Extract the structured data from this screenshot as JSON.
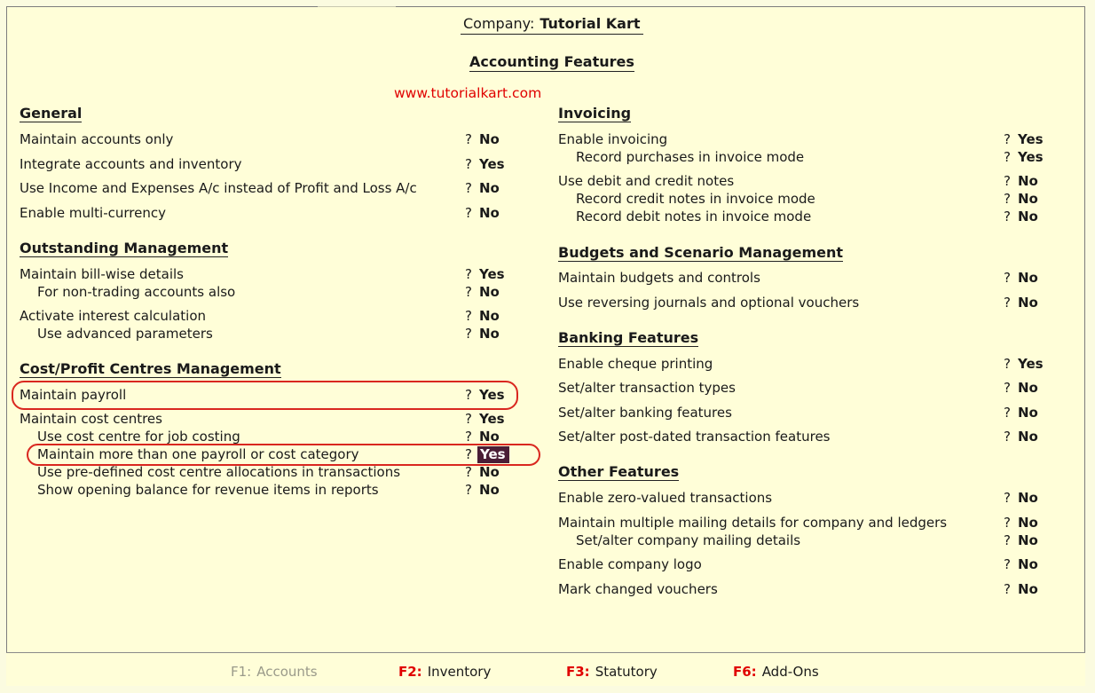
{
  "header": {
    "company_label": "Company:",
    "company_name": "Tutorial Kart",
    "title": "Accounting Features",
    "watermark": "www.tutorialkart.com"
  },
  "left": {
    "general": {
      "title": "General",
      "rows": [
        {
          "label": "Maintain accounts only",
          "q": "?",
          "value": "No"
        },
        {
          "label": "Integrate accounts and inventory",
          "q": "?",
          "value": "Yes"
        },
        {
          "label": "Use Income and Expenses A/c instead of Profit and Loss A/c",
          "q": "?",
          "value": "No"
        },
        {
          "label": "Enable multi-currency",
          "q": "?",
          "value": "No"
        }
      ]
    },
    "outstanding": {
      "title": "Outstanding Management",
      "rows": [
        {
          "label": "Maintain bill-wise details",
          "q": "?",
          "value": "Yes"
        },
        {
          "label": "For non-trading accounts also",
          "q": "?",
          "value": "No"
        },
        {
          "label": "Activate interest calculation",
          "q": "?",
          "value": "No"
        },
        {
          "label": "Use advanced parameters",
          "q": "?",
          "value": "No"
        }
      ]
    },
    "cost": {
      "title": "Cost/Profit Centres Management",
      "rows": [
        {
          "label": "Maintain payroll",
          "q": "?",
          "value": "Yes"
        },
        {
          "label": "Maintain cost centres",
          "q": "?",
          "value": "Yes"
        },
        {
          "label": "Use cost centre for job costing",
          "q": "?",
          "value": "No"
        },
        {
          "label": "Maintain more than one payroll or cost category",
          "q": "?",
          "value": "Yes"
        },
        {
          "label": "Use pre-defined cost centre allocations in transactions",
          "q": "?",
          "value": "No"
        },
        {
          "label": "Show opening balance for revenue items in reports",
          "q": "?",
          "value": "No"
        }
      ]
    }
  },
  "right": {
    "invoicing": {
      "title": "Invoicing",
      "rows": [
        {
          "label": "Enable invoicing",
          "q": "?",
          "value": "Yes"
        },
        {
          "label": "Record purchases in invoice mode",
          "q": "?",
          "value": "Yes"
        },
        {
          "label": "Use debit and credit notes",
          "q": "?",
          "value": "No"
        },
        {
          "label": "Record credit notes in invoice mode",
          "q": "?",
          "value": "No"
        },
        {
          "label": "Record debit notes in invoice mode",
          "q": "?",
          "value": "No"
        }
      ]
    },
    "budgets": {
      "title": "Budgets and Scenario Management",
      "rows": [
        {
          "label": "Maintain budgets and controls",
          "q": "?",
          "value": "No"
        },
        {
          "label": "Use reversing journals and optional vouchers",
          "q": "?",
          "value": "No"
        }
      ]
    },
    "banking": {
      "title": "Banking Features",
      "rows": [
        {
          "label": "Enable cheque printing",
          "q": "?",
          "value": "Yes"
        },
        {
          "label": "Set/alter transaction types",
          "q": "?",
          "value": "No"
        },
        {
          "label": "Set/alter banking features",
          "q": "?",
          "value": "No"
        },
        {
          "label": "Set/alter post-dated transaction features",
          "q": "?",
          "value": "No"
        }
      ]
    },
    "other": {
      "title": "Other Features",
      "rows": [
        {
          "label": "Enable zero-valued transactions",
          "q": "?",
          "value": "No"
        },
        {
          "label": "Maintain multiple mailing details for company and ledgers",
          "q": "?",
          "value": "No"
        },
        {
          "label": "Set/alter company mailing details",
          "q": "?",
          "value": "No"
        },
        {
          "label": "Enable company logo",
          "q": "?",
          "value": "No"
        },
        {
          "label": "Mark changed vouchers",
          "q": "?",
          "value": "No"
        }
      ]
    }
  },
  "footer": {
    "buttons": [
      {
        "key": "F1:",
        "label": "Accounts"
      },
      {
        "key": "F2:",
        "label": "Inventory"
      },
      {
        "key": "F3:",
        "label": "Statutory"
      },
      {
        "key": "F6:",
        "label": "Add-Ons"
      }
    ]
  },
  "colors": {
    "background": "#fffed8",
    "highlight": "#4a1e36",
    "annotation": "#d9271f",
    "hotkey": "#e00000"
  }
}
